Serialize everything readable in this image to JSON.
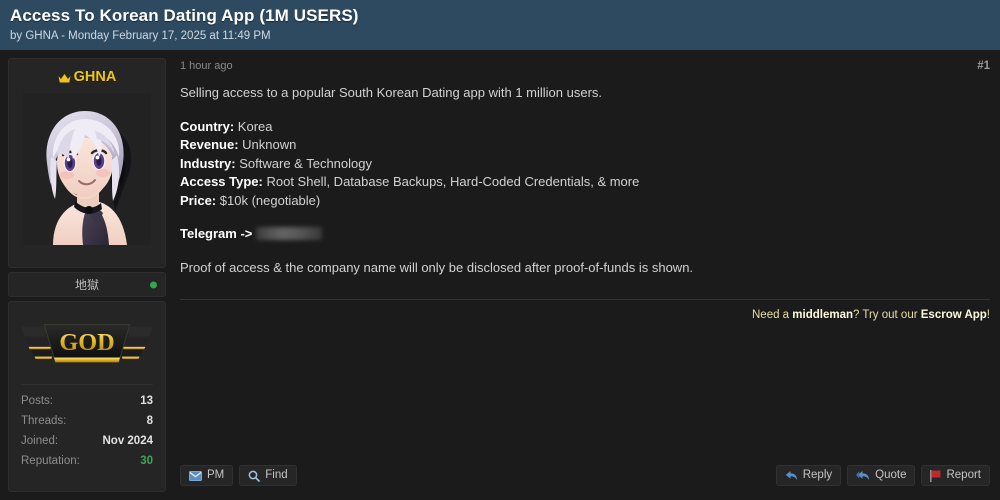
{
  "thread": {
    "title": "Access To Korean Dating App (1M USERS)",
    "byline": "by GHNA - Monday February 17, 2025 at 11:49 PM"
  },
  "author": {
    "username": "GHNA",
    "crown_icon": "crown-icon",
    "avatar_alt": "anime-character-avatar",
    "user_title": "地獄",
    "online_status": "online",
    "rank_badge": "GOD",
    "stats": [
      {
        "label": "Posts:",
        "value": "13"
      },
      {
        "label": "Threads:",
        "value": "8"
      },
      {
        "label": "Joined:",
        "value": "Nov 2024"
      },
      {
        "label": "Reputation:",
        "value": "30"
      }
    ]
  },
  "post": {
    "date": "1 hour ago",
    "number": "#1",
    "intro": "Selling access to a popular South Korean Dating app with 1 million users.",
    "fields": [
      {
        "label": "Country:",
        "value": "Korea"
      },
      {
        "label": "Revenue:",
        "value": "Unknown"
      },
      {
        "label": "Industry:",
        "value": "Software & Technology"
      },
      {
        "label": "Access Type:",
        "value": "Root Shell, Database Backups, Hard-Coded Credentials, & more"
      },
      {
        "label": "Price:",
        "value": "$10k (negotiable)"
      }
    ],
    "telegram_label": "Telegram ->",
    "telegram_value_redacted": true,
    "outro": "Proof of access & the company name will only be disclosed after proof-of-funds is shown."
  },
  "escrow": {
    "pre": "Need a ",
    "strong1": "middleman",
    "mid": "? Try out our ",
    "strong2": "Escrow App",
    "post": "!"
  },
  "footer": {
    "left_buttons": [
      {
        "label": "PM",
        "icon": "envelope-icon"
      },
      {
        "label": "Find",
        "icon": "search-icon"
      }
    ],
    "right_buttons": [
      {
        "label": "Reply",
        "icon": "reply-arrow-icon"
      },
      {
        "label": "Quote",
        "icon": "quote-arrows-icon"
      },
      {
        "label": "Report",
        "icon": "flag-icon"
      }
    ]
  },
  "colors": {
    "header_bg": "#2d4a61",
    "page_bg": "#1b1b1b",
    "card_bg": "#252525",
    "username": "#f0c419",
    "reputation": "#3aa84f",
    "online": "#2faa4a",
    "escrow_text": "#e8dfa8",
    "report_flag": "#c0282d",
    "action_icon_blue": "#4a7fb5"
  }
}
